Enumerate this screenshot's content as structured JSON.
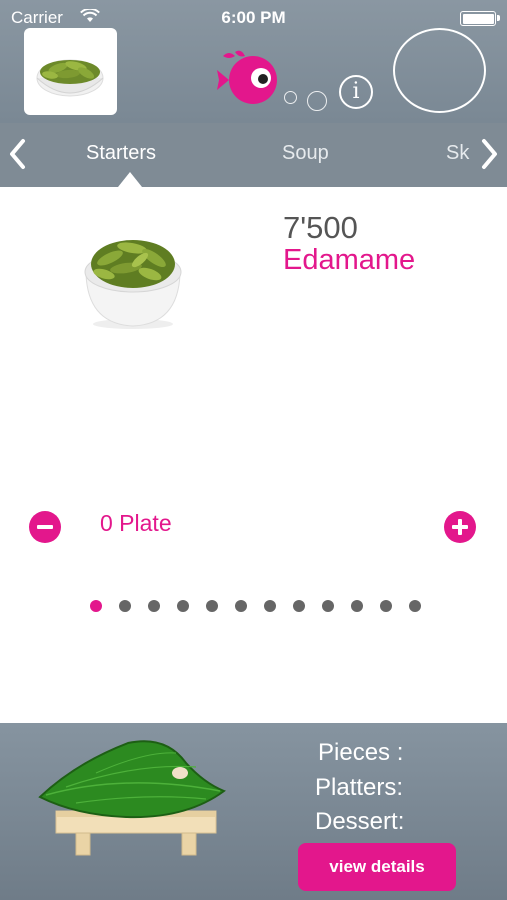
{
  "status_bar": {
    "carrier": "Carrier",
    "time": "6:00 PM"
  },
  "header": {
    "info_glyph": "i"
  },
  "tabs": [
    {
      "label": "Starters",
      "active": true
    },
    {
      "label": "Soup",
      "active": false
    },
    {
      "label": "Sk",
      "active": false
    }
  ],
  "product": {
    "price": "7'500",
    "name": "Edamame"
  },
  "quantity": {
    "label": "0 Plate"
  },
  "pager": {
    "count": 12,
    "active_index": 0
  },
  "summary": {
    "pieces_label": "Pieces :",
    "platters_label": "Platters:",
    "dessert_label": "Dessert:",
    "view_details_label": "view details"
  },
  "colors": {
    "accent": "#e3178c",
    "header": "#7f8b95",
    "dot_inactive": "#666666"
  },
  "icons": {
    "back": "chevron-left-icon",
    "forward": "chevron-right-icon",
    "minus": "minus-icon",
    "plus": "plus-icon",
    "info": "info-icon",
    "logo": "fish-logo-icon"
  }
}
